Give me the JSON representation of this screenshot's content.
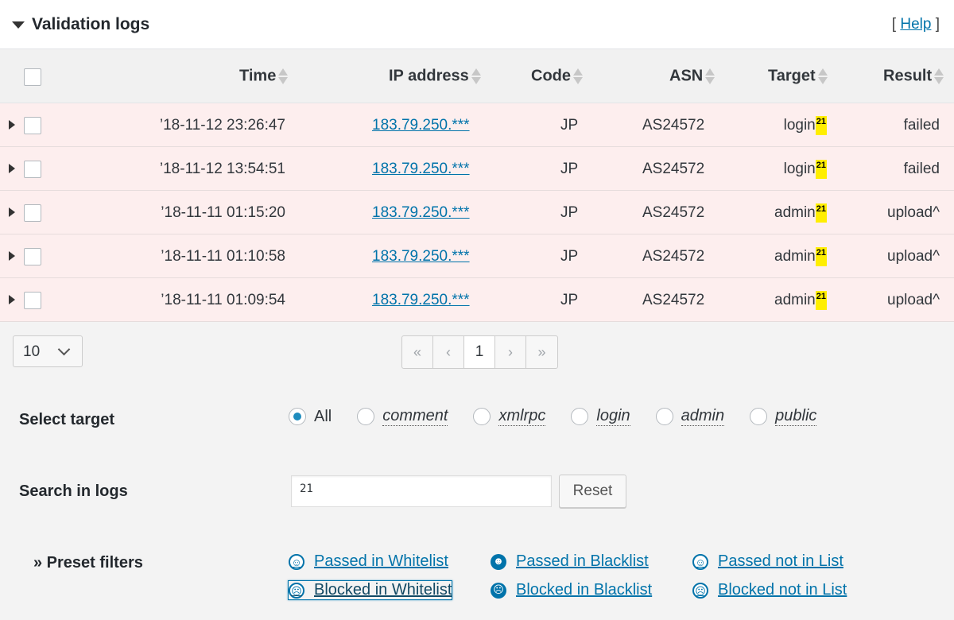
{
  "header": {
    "title": "Validation logs",
    "help_open": "[",
    "help_label": "Help",
    "help_close": "]"
  },
  "table": {
    "columns": [
      "Time",
      "IP address",
      "Code",
      "ASN",
      "Target",
      "Result"
    ],
    "rows": [
      {
        "time": "’18-11-12 23:26:47",
        "ip": "183.79.250.***",
        "code": "JP",
        "asn": "AS24572",
        "target": "login",
        "badge": "21",
        "result": "failed"
      },
      {
        "time": "’18-11-12 13:54:51",
        "ip": "183.79.250.***",
        "code": "JP",
        "asn": "AS24572",
        "target": "login",
        "badge": "21",
        "result": "failed"
      },
      {
        "time": "’18-11-11 01:15:20",
        "ip": "183.79.250.***",
        "code": "JP",
        "asn": "AS24572",
        "target": "admin",
        "badge": "21",
        "result": "upload^"
      },
      {
        "time": "’18-11-11 01:10:58",
        "ip": "183.79.250.***",
        "code": "JP",
        "asn": "AS24572",
        "target": "admin",
        "badge": "21",
        "result": "upload^"
      },
      {
        "time": "’18-11-11 01:09:54",
        "ip": "183.79.250.***",
        "code": "JP",
        "asn": "AS24572",
        "target": "admin",
        "badge": "21",
        "result": "upload^"
      }
    ],
    "row_color": "#fdeeee"
  },
  "pagination": {
    "per_page": "10",
    "first": "«",
    "prev": "‹",
    "current": "1",
    "next": "›",
    "last": "»"
  },
  "filters": {
    "select_target_label": "Select target",
    "targets": [
      "All",
      "comment",
      "xmlrpc",
      "login",
      "admin",
      "public"
    ],
    "selected_target": "All",
    "search_label": "Search in logs",
    "search_value": "21",
    "reset_label": "Reset",
    "preset_label": "» Preset filters",
    "presets": [
      {
        "label": "Passed in Whitelist",
        "icon": "smile-outline-icon",
        "glyph": "☺"
      },
      {
        "label": "Passed in Blacklist",
        "icon": "grin-solid-icon",
        "glyph": "☻"
      },
      {
        "label": "Passed not in List",
        "icon": "cool-outline-icon",
        "glyph": "☺"
      },
      {
        "label": "Blocked in Whitelist",
        "icon": "frown-outline-icon",
        "glyph": "☹"
      },
      {
        "label": "Blocked in Blacklist",
        "icon": "frown-solid-icon",
        "glyph": "☹"
      },
      {
        "label": "Blocked not in List",
        "icon": "meh-outline-icon",
        "glyph": "☹"
      }
    ]
  },
  "colors": {
    "link": "#0073aa",
    "badge": "#ffee00",
    "radio_selected": "#1e8cbe"
  }
}
